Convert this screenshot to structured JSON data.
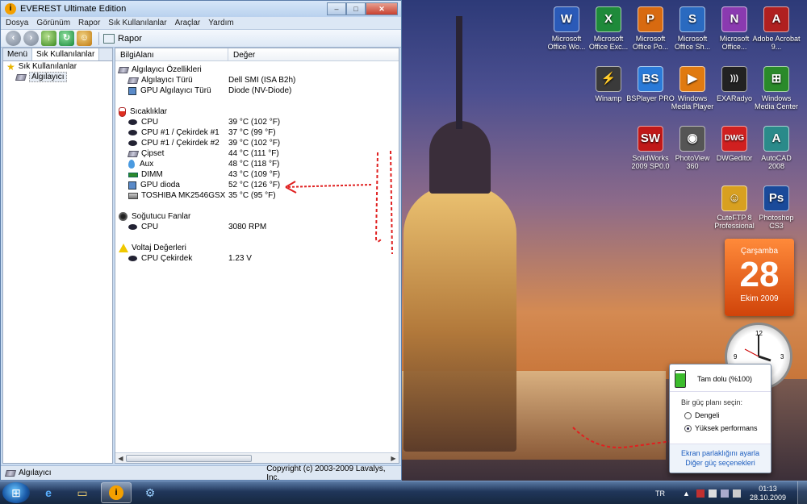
{
  "window": {
    "title": "EVEREST Ultimate Edition",
    "min": "–",
    "max": "□",
    "close": "✕"
  },
  "menu": [
    "Dosya",
    "Görünüm",
    "Rapor",
    "Sık Kullanılanlar",
    "Araçlar",
    "Yardım"
  ],
  "toolbar": {
    "report_label": "Rapor"
  },
  "left_pane": {
    "tabs": [
      "Menü",
      "Sık Kullanılanlar"
    ],
    "tree_root": "Sık Kullanılanlar",
    "tree_child": "Algılayıcı"
  },
  "columns": {
    "field": "BilgiAlanı",
    "value": "Değer"
  },
  "sections": {
    "props": {
      "title": "Algılayıcı Özellikleri",
      "rows": [
        {
          "k": "Algılayıcı Türü",
          "v": "Dell SMI  (ISA B2h)"
        },
        {
          "k": "GPU Algılayıcı Türü",
          "v": "Diode  (NV-Diode)"
        }
      ]
    },
    "temps": {
      "title": "Sıcaklıklar",
      "rows": [
        {
          "k": "CPU",
          "v": "39 °C  (102 °F)"
        },
        {
          "k": "CPU #1 / Çekirdek #1",
          "v": "37 °C  (99 °F)"
        },
        {
          "k": "CPU #1 / Çekirdek #2",
          "v": "39 °C  (102 °F)"
        },
        {
          "k": "Çipset",
          "v": "44 °C  (111 °F)"
        },
        {
          "k": "Aux",
          "v": "48 °C  (118 °F)"
        },
        {
          "k": "DIMM",
          "v": "43 °C  (109 °F)"
        },
        {
          "k": "GPU dioda",
          "v": "52 °C  (126 °F)"
        },
        {
          "k": "TOSHIBA MK2546GSX",
          "v": "35 °C  (95 °F)"
        }
      ]
    },
    "fans": {
      "title": "Soğutucu Fanlar",
      "rows": [
        {
          "k": "CPU",
          "v": "3080 RPM"
        }
      ]
    },
    "volts": {
      "title": "Voltaj Değerleri",
      "rows": [
        {
          "k": "CPU Çekirdek",
          "v": "1.23 V"
        }
      ]
    }
  },
  "statusbar": {
    "left": "Algılayıcı",
    "right": "Copyright (c) 2003-2009 Lavalys, Inc."
  },
  "desktop_icons": [
    {
      "label": "Microsoft Office Wo...",
      "glyph": "W",
      "color": "#2a5ab8"
    },
    {
      "label": "Microsoft Office Exc...",
      "glyph": "X",
      "color": "#1e8a3a"
    },
    {
      "label": "Microsoft Office Po...",
      "glyph": "P",
      "color": "#d86a10"
    },
    {
      "label": "Microsoft Office Sh...",
      "glyph": "S",
      "color": "#2a6ac0"
    },
    {
      "label": "Microsoft Office...",
      "glyph": "N",
      "color": "#8a3ab0"
    },
    {
      "label": "Adobe Acrobat 9...",
      "glyph": "A",
      "color": "#b02020"
    },
    {
      "label": "Winamp",
      "glyph": "⚡",
      "color": "#3a3a3a"
    },
    {
      "label": "BSPlayer PRO",
      "glyph": "BS",
      "color": "#2a7ad8"
    },
    {
      "label": "Windows Media Player",
      "glyph": "▶",
      "color": "#e07a10"
    },
    {
      "label": "EXARadyo",
      "glyph": ")))",
      "color": "#222222"
    },
    {
      "label": "Windows Media Center",
      "glyph": "⊞",
      "color": "#2a8a2a"
    },
    {
      "label": "SolidWorks 2009 SP0.0",
      "glyph": "SW",
      "color": "#c01818"
    },
    {
      "label": "PhotoView 360",
      "glyph": "◉",
      "color": "#555555"
    },
    {
      "label": "DWGeditor",
      "glyph": "DWG",
      "color": "#d02020"
    },
    {
      "label": "AutoCAD 2008",
      "glyph": "A",
      "color": "#2a8a8a"
    },
    {
      "label": "CuteFTP 8 Professional",
      "glyph": "☺",
      "color": "#d8a020"
    },
    {
      "label": "Photoshop CS3",
      "glyph": "Ps",
      "color": "#1a4a9a"
    }
  ],
  "calendar": {
    "day_of_week": "Çarşamba",
    "day": "28",
    "month_year": "Ekim 2009"
  },
  "power": {
    "status": "Tam dolu (%100)",
    "prompt": "Bir güç planı seçin:",
    "plans": [
      {
        "label": "Dengeli",
        "selected": false
      },
      {
        "label": "Yüksek performans",
        "selected": true
      }
    ],
    "link1": "Ekran parlaklığını ayarla",
    "link2": "Diğer güç seçenekleri"
  },
  "taskbar": {
    "start": "⊞",
    "lang": "TR",
    "time": "01:13",
    "date": "28.10.2009"
  }
}
